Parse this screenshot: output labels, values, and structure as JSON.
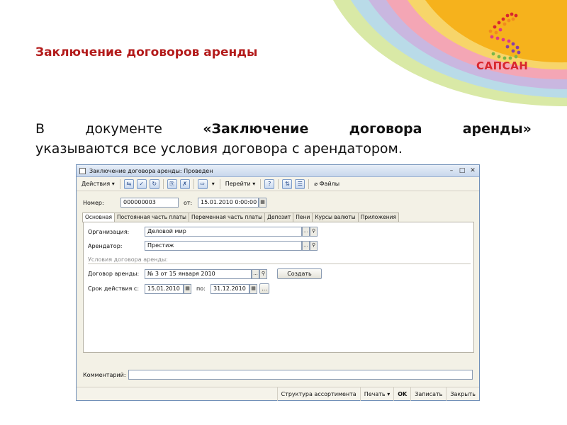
{
  "slide": {
    "title": "Заключение договоров аренды",
    "text_line1_words": [
      "В",
      "документе",
      "«Заключение",
      "договора",
      "аренды»"
    ],
    "text_line2": "указываются все условия договора с арендатором."
  },
  "logo": {
    "text": "САПСАН",
    "icon": "dot-s-logo"
  },
  "window": {
    "title": "Заключение договора аренды: Проведен",
    "toolbar": {
      "actions_label": "Действия",
      "goto_label": "Перейти",
      "help_label": "?",
      "files_label": "Файлы"
    },
    "number_label": "Номер:",
    "number_value": "000000003",
    "date_label": "от:",
    "date_value": "15.01.2010  0:00:00",
    "tabs": [
      "Основная",
      "Постоянная часть платы",
      "Переменная часть платы",
      "Депозит",
      "Пени",
      "Курсы валюты",
      "Приложения"
    ],
    "org_label": "Организация:",
    "org_value": "Деловой мир",
    "tenant_label": "Арендатор:",
    "tenant_value": "Престиж",
    "section_label": "Условия договора аренды:",
    "contract_label": "Договор аренды:",
    "contract_value": "№ 3 от 15 января 2010",
    "create_label": "Создать",
    "term_label": "Срок действия с:",
    "term_from": "15.01.2010",
    "term_to_label": "по:",
    "term_to": "31.12.2010",
    "ellipsis": "...",
    "comment_label": "Комментарий:",
    "comment_value": "",
    "bottom": {
      "structure": "Структура ассортимента",
      "print": "Печать",
      "ok": "OK",
      "save": "Записать",
      "close": "Закрыть"
    }
  },
  "colors": {
    "title": "#b31b1b",
    "logo": "#d8262e",
    "accent_orange": "#f6b21c"
  }
}
